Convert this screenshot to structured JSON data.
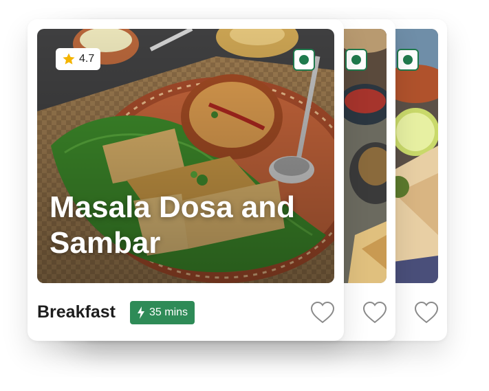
{
  "cards": [
    {
      "title": "Masala Dosa and Sambar",
      "rating": "4.7",
      "meal": "Breakfast",
      "time": "35 mins",
      "veg_icon": "veg-indicator-icon",
      "rating_icon": "star-icon",
      "time_icon": "bolt-icon",
      "favorite_icon": "heart-outline-icon"
    }
  ],
  "colors": {
    "accent_green": "#2e8b57",
    "veg_green": "#1f7a4d",
    "star_yellow": "#f4b400",
    "title_text": "#ffffff",
    "body_text": "#1d1d1d"
  }
}
